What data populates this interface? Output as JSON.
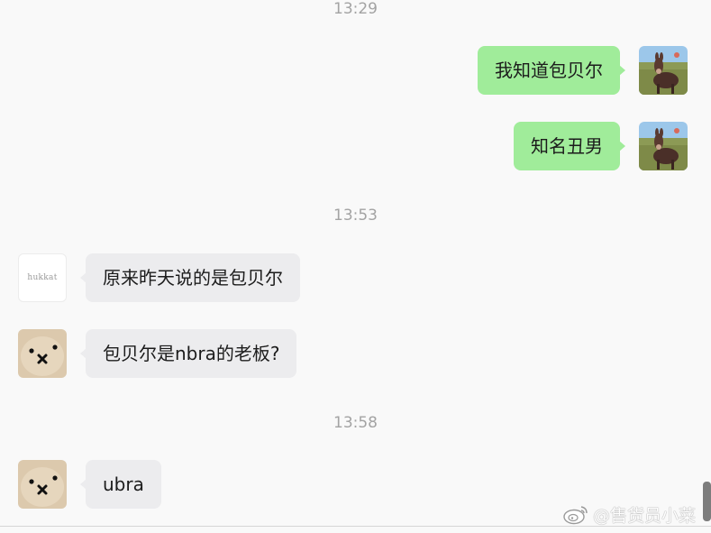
{
  "timestamps": {
    "t1": "13:29",
    "t2": "13:53",
    "t3": "13:58"
  },
  "messages": [
    {
      "side": "out",
      "text": "我知道包贝尔",
      "avatar": "donkey-avatar"
    },
    {
      "side": "out",
      "text": "知名丑男",
      "avatar": "donkey-avatar"
    },
    {
      "side": "in",
      "text": "原来昨天说的是包贝尔",
      "avatar": "hukkat-logo-avatar"
    },
    {
      "side": "in",
      "text": "包贝尔是nbra的老板?",
      "avatar": "bunny-face-avatar"
    },
    {
      "side": "in",
      "text": "ubra",
      "avatar": "bunny-face-avatar"
    }
  ],
  "avatars": {
    "logo_text": "hukkat"
  },
  "watermark": {
    "icon": "weibo-icon",
    "text": "@售货员小菜"
  },
  "colors": {
    "background": "#f9f9f9",
    "outgoing_bubble": "#a0ec9a",
    "incoming_bubble": "#ececee",
    "timestamp": "#a3a3a3"
  }
}
